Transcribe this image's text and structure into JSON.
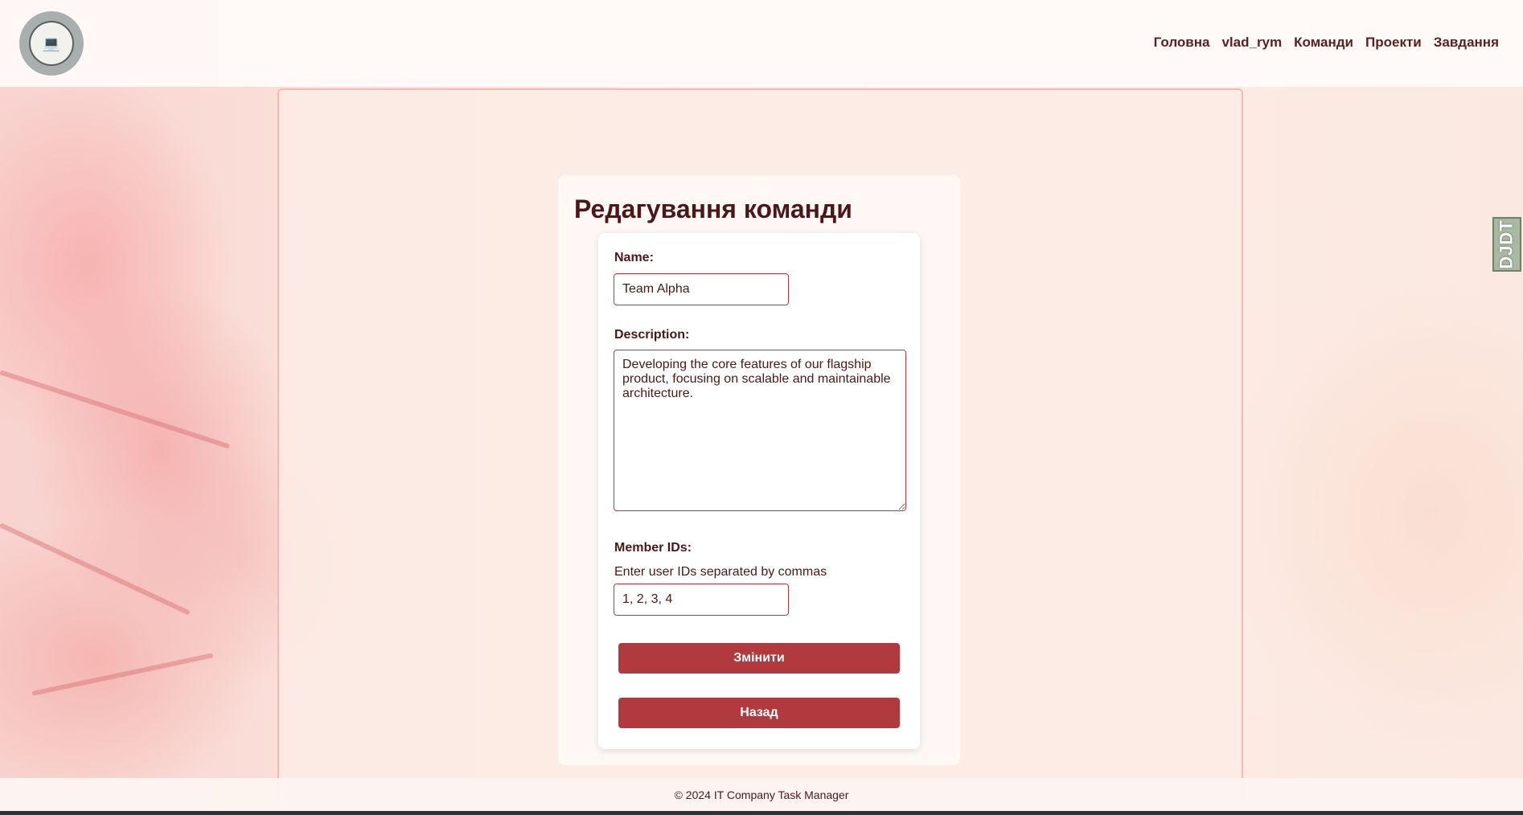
{
  "header": {
    "logo_icon": "laptop-logo-icon",
    "nav": [
      {
        "label": "Головна"
      },
      {
        "label": "vlad_rym"
      },
      {
        "label": "Команди"
      },
      {
        "label": "Проекти"
      },
      {
        "label": "Завдання"
      }
    ]
  },
  "main": {
    "title": "Редагування команди",
    "form": {
      "name_label": "Name:",
      "name_value": "Team Alpha",
      "description_label": "Description:",
      "description_value": "Developing the core features of our flagship product, focusing on scalable and maintainable architecture.",
      "members_label": "Member IDs:",
      "members_help": "Enter user IDs separated by commas",
      "members_value": "1, 2, 3, 4",
      "submit_label": "Змінити",
      "back_label": "Назад"
    }
  },
  "footer": {
    "text": "© 2024 IT Company Task Manager"
  },
  "debug_toolbar": {
    "label": "DJDT"
  },
  "colors": {
    "accent": "#b03a3e",
    "text": "#4a1818",
    "background": "#fbe9e4"
  }
}
